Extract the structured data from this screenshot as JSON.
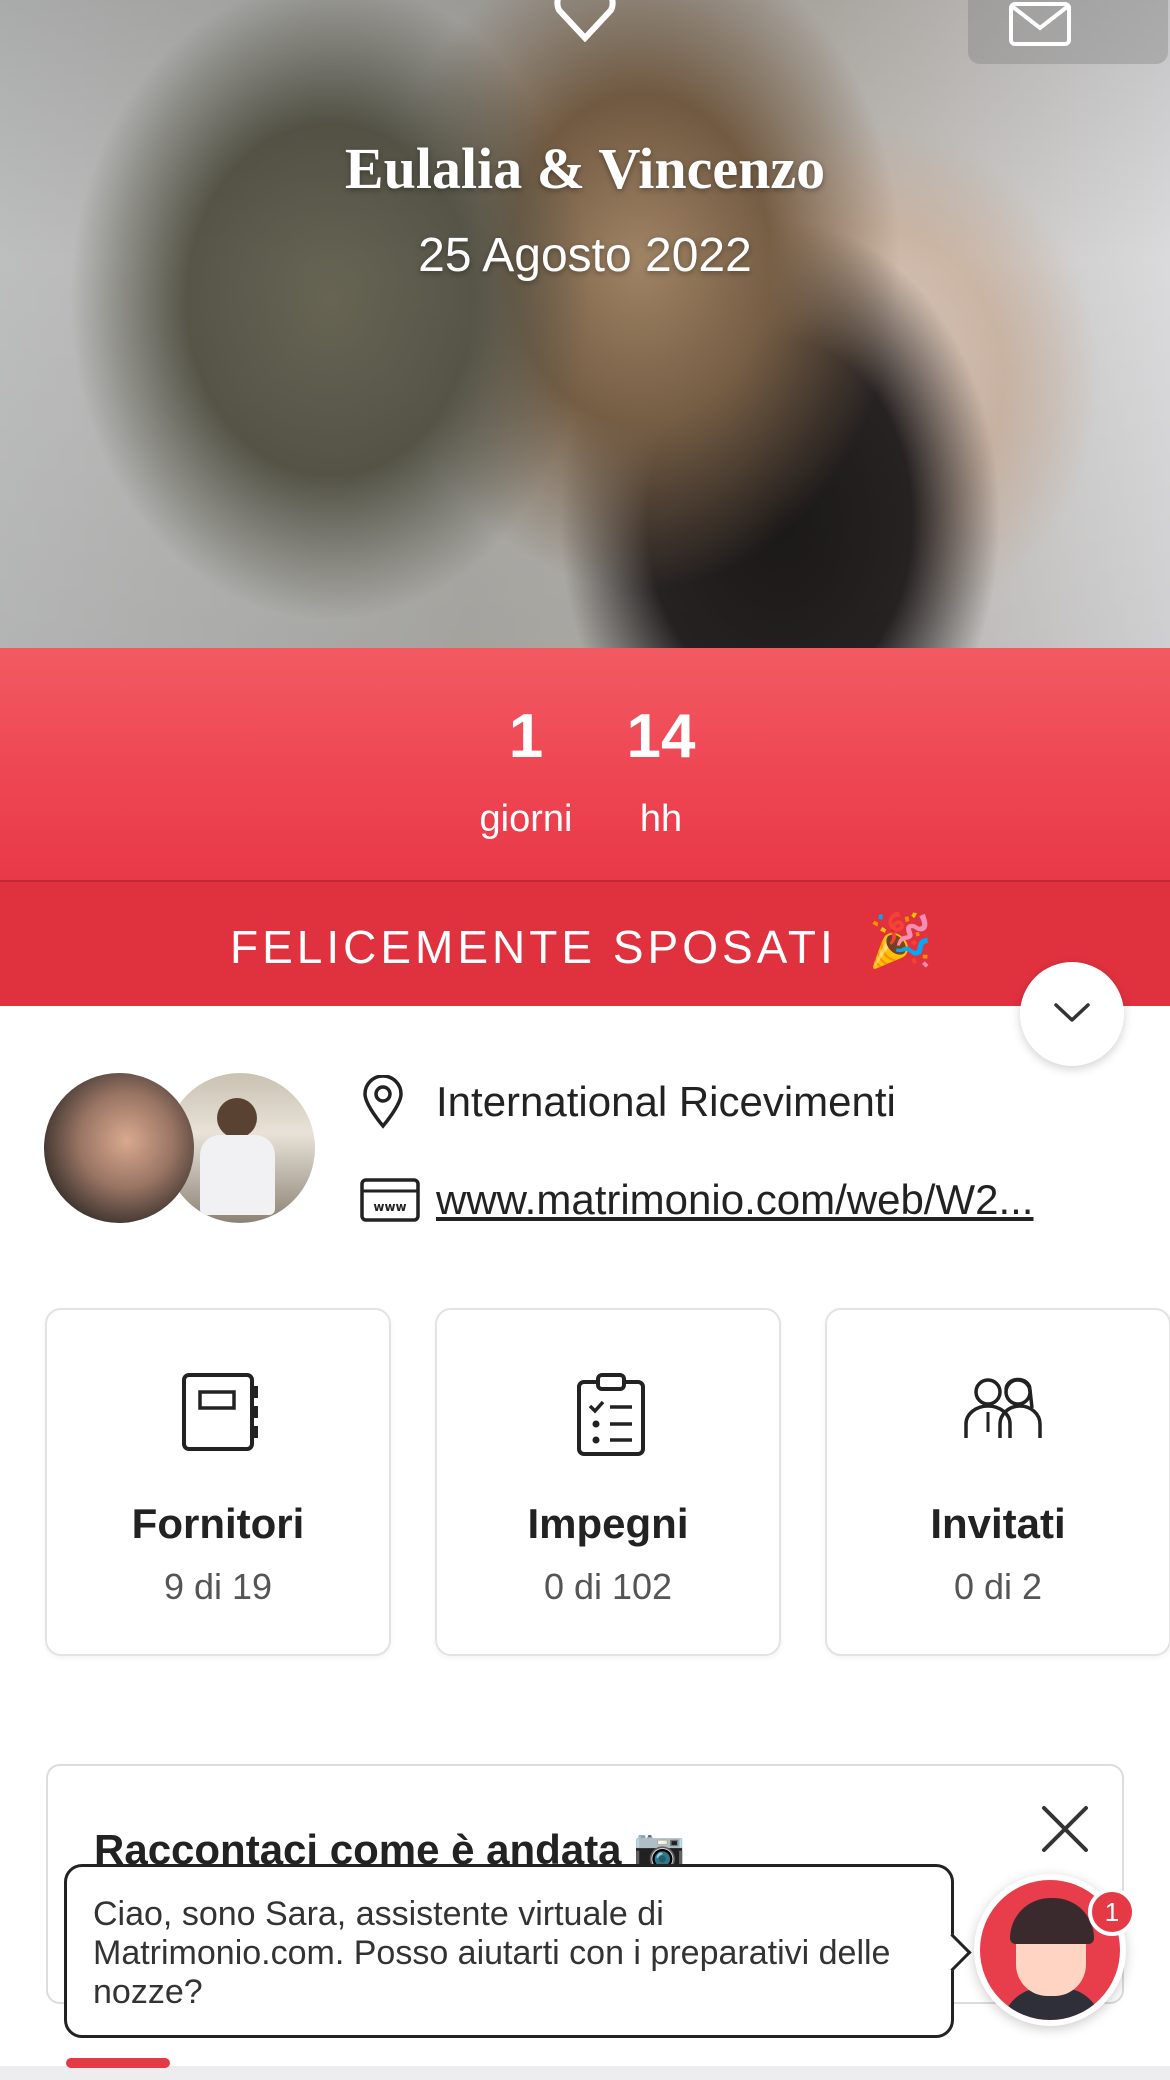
{
  "hero": {
    "title": "Eulalia & Vincenzo",
    "date": "25 Agosto 2022",
    "icons": {
      "logo": "heart-location-icon",
      "mail": "mail-icon"
    }
  },
  "countdown": {
    "days": {
      "value": "1",
      "label": "giorni"
    },
    "hours": {
      "value": "14",
      "label": "hh"
    }
  },
  "status_banner": {
    "text": "FELICEMENTE SPOSATI",
    "emoji": "🎉"
  },
  "profile": {
    "location": "International Ricevimenti",
    "website": "www.matrimonio.com/web/W2..."
  },
  "cards": [
    {
      "title": "Fornitori",
      "subtitle": "9 di 19",
      "icon": "notebook-icon"
    },
    {
      "title": "Impegni",
      "subtitle": "0 di 102",
      "icon": "clipboard-checklist-icon"
    },
    {
      "title": "Invitati",
      "subtitle": "0 di 2",
      "icon": "guests-icon"
    }
  ],
  "story_card": {
    "title": "Raccontaci come è andata 📷"
  },
  "assistant": {
    "message": "Ciao, sono Sara, assistente virtuale di Matrimonio.com. Posso aiutarti con i preparativi delle nozze?",
    "badge": "1"
  },
  "colors": {
    "accent": "#e83948",
    "banner": "#e0313f",
    "text": "#222222"
  }
}
